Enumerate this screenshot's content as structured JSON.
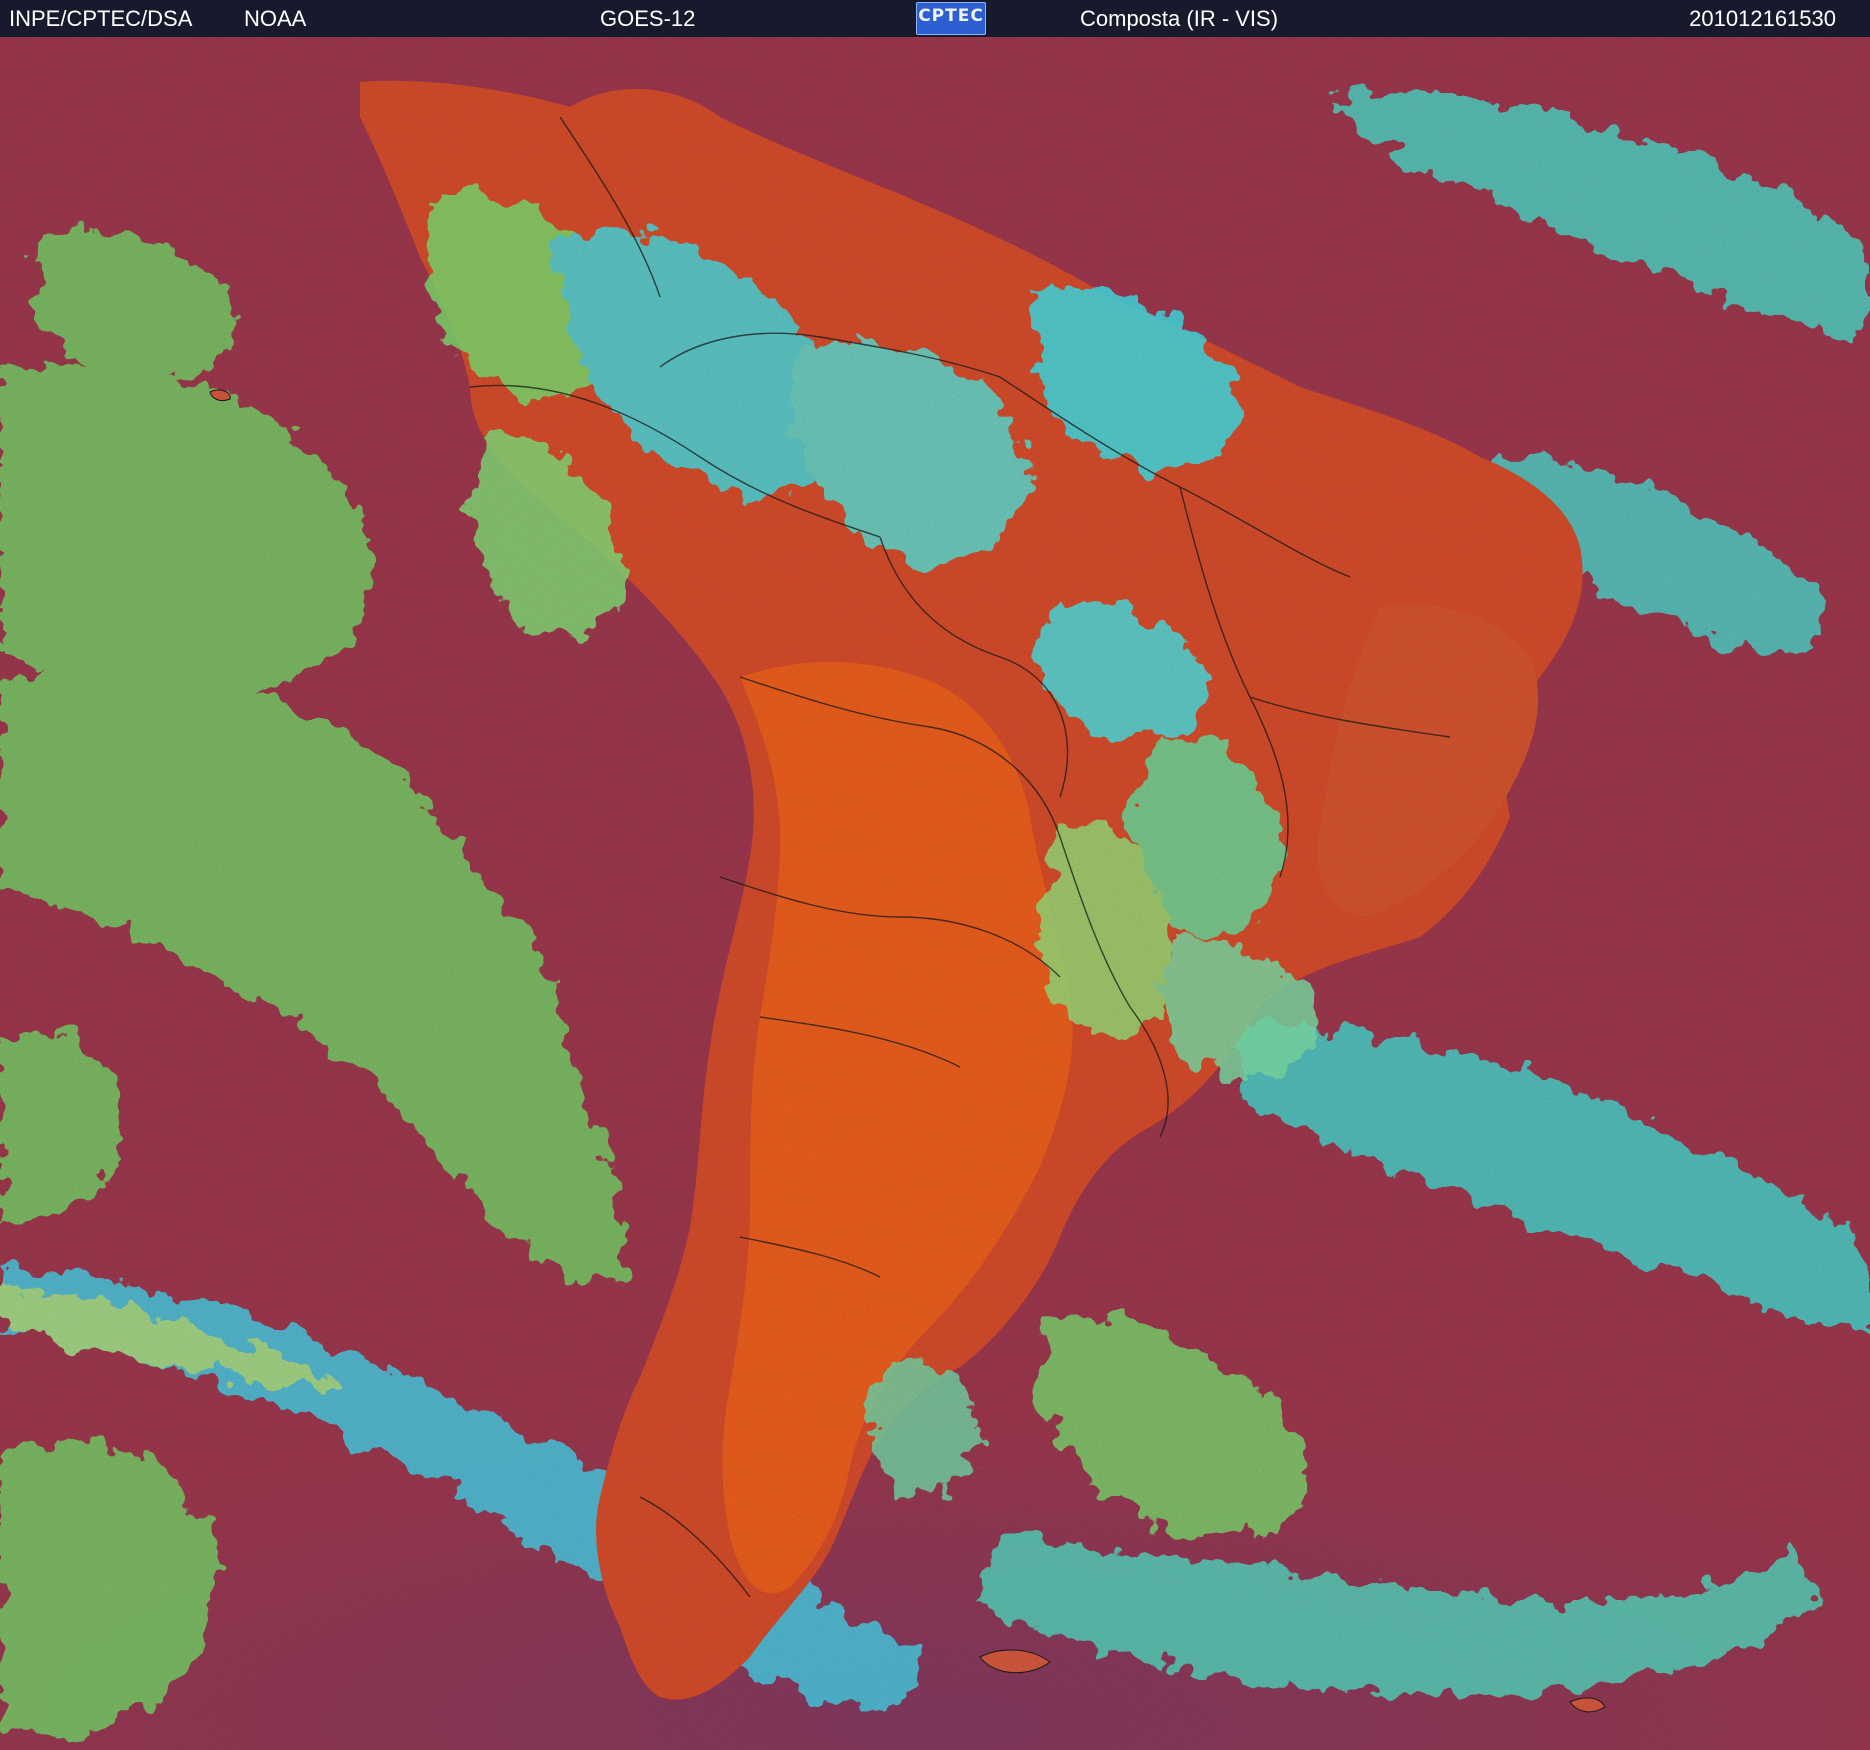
{
  "header": {
    "org": "INPE/CPTEC/DSA",
    "agency": "NOAA",
    "satellite": "GOES-12",
    "product": "Composta (IR - VIS)",
    "timestamp": "201012161530",
    "logo_text": "CPTEC"
  },
  "colors": {
    "header_bg": "#161a2c",
    "ocean_clear": "#a0394f",
    "ocean_far_south": "#7d3a64",
    "land_clear": "#e0522a",
    "land_hot": "#f0601e",
    "low_cloud": "#7fe070",
    "high_cloud": "#38e8ec",
    "borders": "#1a1a1a"
  }
}
